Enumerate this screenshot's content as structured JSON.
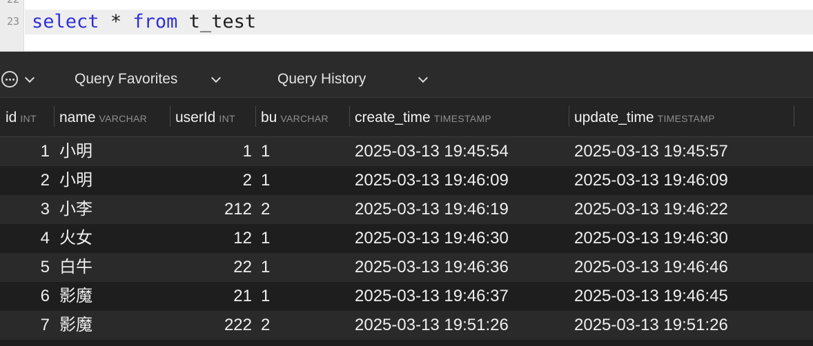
{
  "editor": {
    "gutter_lines": [
      "22",
      "23"
    ],
    "query": {
      "kw1": "select",
      "op": "*",
      "kw2": "from",
      "table": "t_test"
    }
  },
  "toolbar": {
    "favorites_label": "Query Favorites",
    "history_label": "Query History"
  },
  "columns": [
    {
      "name": "id",
      "type": "INT"
    },
    {
      "name": "name",
      "type": "VARCHAR"
    },
    {
      "name": "userId",
      "type": "INT"
    },
    {
      "name": "bu",
      "type": "VARCHAR"
    },
    {
      "name": "create_time",
      "type": "TIMESTAMP"
    },
    {
      "name": "update_time",
      "type": "TIMESTAMP"
    }
  ],
  "rows": [
    [
      "1",
      "小明",
      "1",
      "1",
      "2025-03-13 19:45:54",
      "2025-03-13 19:45:57"
    ],
    [
      "2",
      "小明",
      "2",
      "1",
      "2025-03-13 19:46:09",
      "2025-03-13 19:46:09"
    ],
    [
      "3",
      "小李",
      "212",
      "2",
      "2025-03-13 19:46:19",
      "2025-03-13 19:46:22"
    ],
    [
      "4",
      "火女",
      "12",
      "1",
      "2025-03-13 19:46:30",
      "2025-03-13 19:46:30"
    ],
    [
      "5",
      "白牛",
      "22",
      "1",
      "2025-03-13 19:46:36",
      "2025-03-13 19:46:46"
    ],
    [
      "6",
      "影魔",
      "21",
      "1",
      "2025-03-13 19:46:37",
      "2025-03-13 19:46:45"
    ],
    [
      "7",
      "影魔",
      "222",
      "2",
      "2025-03-13 19:51:26",
      "2025-03-13 19:51:26"
    ]
  ]
}
